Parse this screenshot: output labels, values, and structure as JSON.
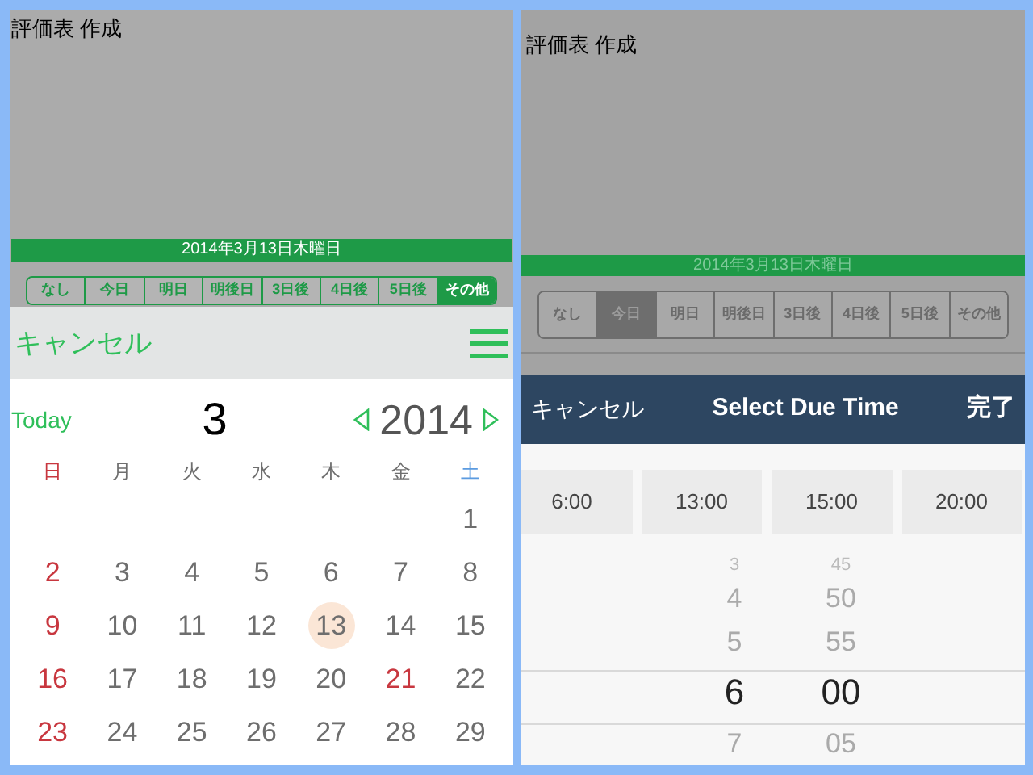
{
  "left": {
    "title": "評価表 作成",
    "date_bar": "2014年3月13日木曜日",
    "segments": [
      {
        "label": "なし",
        "selected": false
      },
      {
        "label": "今日",
        "selected": false
      },
      {
        "label": "明日",
        "selected": false
      },
      {
        "label": "明後日",
        "selected": false
      },
      {
        "label": "3日後",
        "selected": false
      },
      {
        "label": "4日後",
        "selected": false
      },
      {
        "label": "5日後",
        "selected": false
      },
      {
        "label": "その他",
        "selected": true
      }
    ],
    "sheet": {
      "cancel": "キャンセル"
    },
    "calendar": {
      "today": "Today",
      "month": "3",
      "year": "2014",
      "weekdays": [
        {
          "label": "日",
          "kind": "sunday"
        },
        {
          "label": "月",
          "kind": "weekday"
        },
        {
          "label": "火",
          "kind": "weekday"
        },
        {
          "label": "水",
          "kind": "weekday"
        },
        {
          "label": "木",
          "kind": "weekday"
        },
        {
          "label": "金",
          "kind": "weekday"
        },
        {
          "label": "土",
          "kind": "saturday"
        }
      ],
      "weeks": [
        {
          "days": [
            {
              "label": "1",
              "kind": "weekday",
              "selected": false
            }
          ]
        },
        {
          "days": [
            {
              "label": "2",
              "kind": "sunday",
              "selected": false
            },
            {
              "label": "3",
              "kind": "weekday",
              "selected": false
            },
            {
              "label": "4",
              "kind": "weekday",
              "selected": false
            },
            {
              "label": "5",
              "kind": "weekday",
              "selected": false
            },
            {
              "label": "6",
              "kind": "weekday",
              "selected": false
            },
            {
              "label": "7",
              "kind": "weekday",
              "selected": false
            },
            {
              "label": "8",
              "kind": "weekday",
              "selected": false
            }
          ]
        },
        {
          "days": [
            {
              "label": "9",
              "kind": "sunday",
              "selected": false
            },
            {
              "label": "10",
              "kind": "weekday",
              "selected": false
            },
            {
              "label": "11",
              "kind": "weekday",
              "selected": false
            },
            {
              "label": "12",
              "kind": "weekday",
              "selected": false
            },
            {
              "label": "13",
              "kind": "weekday",
              "selected": true
            },
            {
              "label": "14",
              "kind": "weekday",
              "selected": false
            },
            {
              "label": "15",
              "kind": "weekday",
              "selected": false
            }
          ]
        },
        {
          "days": [
            {
              "label": "16",
              "kind": "sunday",
              "selected": false
            },
            {
              "label": "17",
              "kind": "weekday",
              "selected": false
            },
            {
              "label": "18",
              "kind": "weekday",
              "selected": false
            },
            {
              "label": "19",
              "kind": "weekday",
              "selected": false
            },
            {
              "label": "20",
              "kind": "weekday",
              "selected": false
            },
            {
              "label": "21",
              "kind": "holiday",
              "selected": false
            },
            {
              "label": "22",
              "kind": "weekday",
              "selected": false
            }
          ]
        },
        {
          "days": [
            {
              "label": "23",
              "kind": "sunday",
              "selected": false
            },
            {
              "label": "24",
              "kind": "weekday",
              "selected": false
            },
            {
              "label": "25",
              "kind": "weekday",
              "selected": false
            },
            {
              "label": "26",
              "kind": "weekday",
              "selected": false
            },
            {
              "label": "27",
              "kind": "weekday",
              "selected": false
            },
            {
              "label": "28",
              "kind": "weekday",
              "selected": false
            },
            {
              "label": "29",
              "kind": "weekday",
              "selected": false
            }
          ]
        }
      ]
    }
  },
  "right": {
    "title": "評価表 作成",
    "date_bar": "2014年3月13日木曜日",
    "segments": [
      {
        "label": "なし",
        "selected": false
      },
      {
        "label": "今日",
        "selected": true
      },
      {
        "label": "明日",
        "selected": false
      },
      {
        "label": "明後日",
        "selected": false
      },
      {
        "label": "3日後",
        "selected": false
      },
      {
        "label": "4日後",
        "selected": false
      },
      {
        "label": "5日後",
        "selected": false
      },
      {
        "label": "その他",
        "selected": false
      }
    ],
    "header": {
      "cancel": "キャンセル",
      "title": "Select Due Time",
      "done": "完了"
    },
    "presets": [
      "6:00",
      "13:00",
      "15:00",
      "20:00"
    ],
    "picker": {
      "hours": [
        {
          "label": "3",
          "selected": false
        },
        {
          "label": "4",
          "selected": false
        },
        {
          "label": "5",
          "selected": false
        },
        {
          "label": "6",
          "selected": true
        },
        {
          "label": "7",
          "selected": false
        }
      ],
      "minutes": [
        {
          "label": "45",
          "selected": false
        },
        {
          "label": "50",
          "selected": false
        },
        {
          "label": "55",
          "selected": false
        },
        {
          "label": "00",
          "selected": true
        },
        {
          "label": "05",
          "selected": false
        }
      ]
    }
  }
}
